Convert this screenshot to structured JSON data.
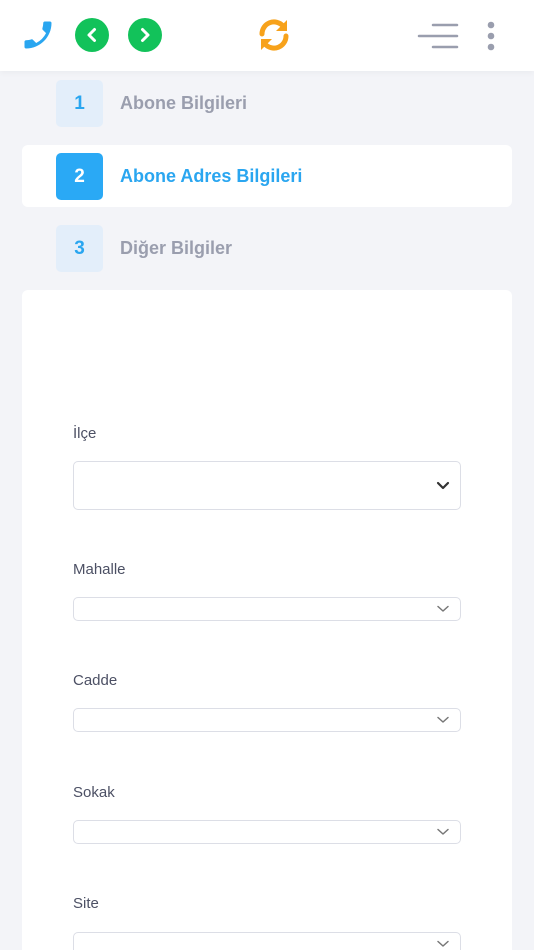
{
  "toolbar": {
    "phone_icon": "phone-icon",
    "back_icon": "chevron-left-icon",
    "forward_icon": "chevron-right-icon",
    "refresh_icon": "refresh-icon",
    "menu_icon": "hamburger-menu-icon",
    "more_icon": "more-vertical-icon",
    "colors": {
      "phone": "#2aa6f0",
      "nav": "#12c25a",
      "refresh": "#f7a21b",
      "menu": "#9a9eae"
    }
  },
  "steps": [
    {
      "number": "1",
      "label": "Abone Bilgileri",
      "state": "inactive"
    },
    {
      "number": "2",
      "label": "Abone Adres Bilgileri",
      "state": "active"
    },
    {
      "number": "3",
      "label": "Diğer Bilgiler",
      "state": "inactive"
    }
  ],
  "form": {
    "fields": [
      {
        "label": "İlçe",
        "value": ""
      },
      {
        "label": "Mahalle",
        "value": ""
      },
      {
        "label": "Cadde",
        "value": ""
      },
      {
        "label": "Sokak",
        "value": ""
      },
      {
        "label": "Site",
        "value": ""
      }
    ]
  },
  "colors": {
    "accent": "#2aa6f0",
    "page_bg": "#f3f4f8",
    "muted_text": "#9a9eae"
  }
}
